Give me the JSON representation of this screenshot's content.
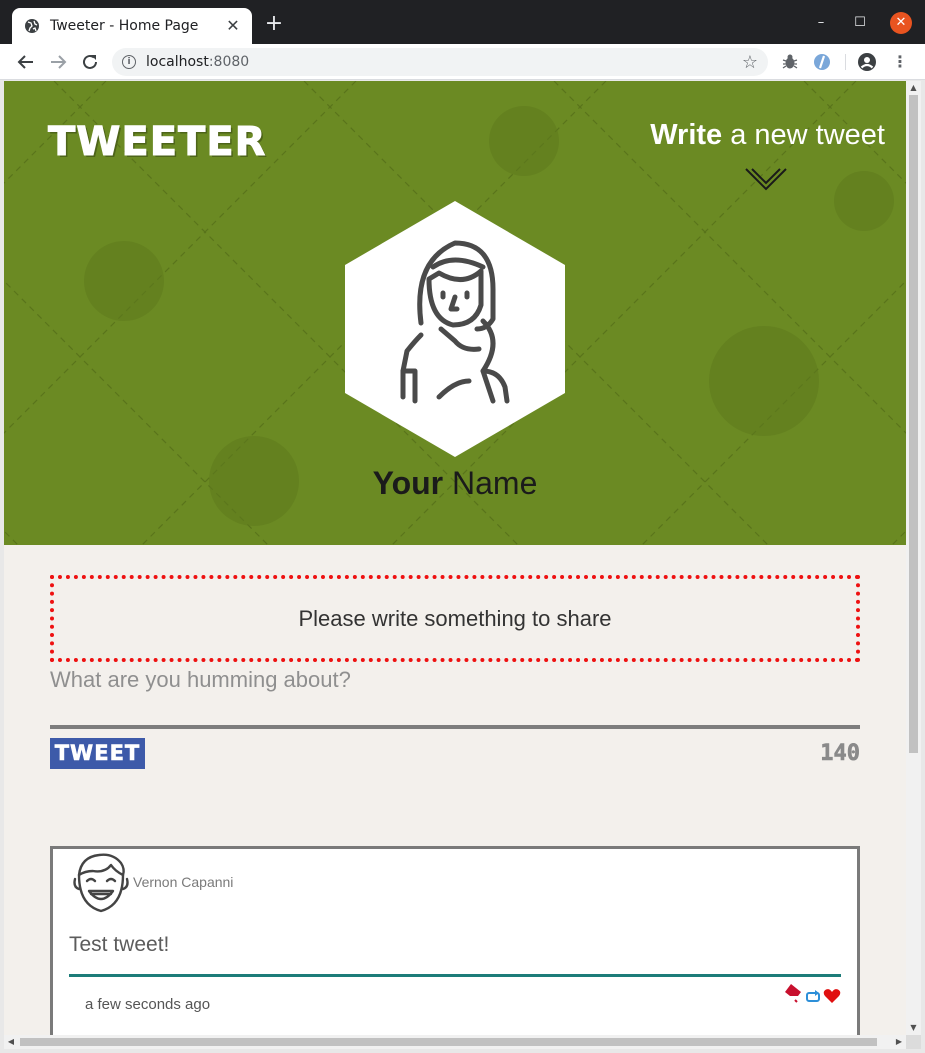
{
  "browser": {
    "tab_title": "Tweeter - Home Page",
    "tab_close": "✕",
    "new_tab": "+",
    "url_host": "localhost",
    "url_port": ":8080",
    "window_min": "–",
    "window_max": "☐",
    "window_close": "✕",
    "menu": "⋮",
    "bookmark_star": "☆",
    "info_glyph": "i",
    "icons": [
      "globe-icon",
      "back-arrow-icon",
      "forward-arrow-icon",
      "reload-icon",
      "info-icon",
      "star-icon",
      "bug-extension-icon",
      "blue-extension-icon",
      "profile-icon",
      "kebab-menu-icon"
    ]
  },
  "header": {
    "brand": "TWEETER",
    "compose_bold": "Write",
    "compose_rest": " a new tweet",
    "toggle_icon": "chevron-down-icon"
  },
  "profile": {
    "name_bold": "Your",
    "name_rest": " Name",
    "avatar_icon": "woman-avatar-icon"
  },
  "compose": {
    "error_message": "Please write something to share",
    "placeholder": "What are you humming about?",
    "submit_label": "TWEET",
    "char_counter": "140"
  },
  "tweets": [
    {
      "author": "Vernon Capanni",
      "avatar_icon": "laughing-man-avatar-icon",
      "body": "Test tweet!",
      "timestamp": "a few seconds ago",
      "actions": [
        "flag-icon",
        "retweet-icon",
        "heart-icon"
      ]
    }
  ],
  "colors": {
    "hero_green": "#6b8a23",
    "page_bg": "#f3f0ec",
    "error_red": "#ee1111",
    "tweet_button_blue": "#3d5aa9",
    "tweet_rule_teal": "#1c7c79",
    "heart_red": "#e01010",
    "retweet_blue": "#2d8fd8"
  }
}
